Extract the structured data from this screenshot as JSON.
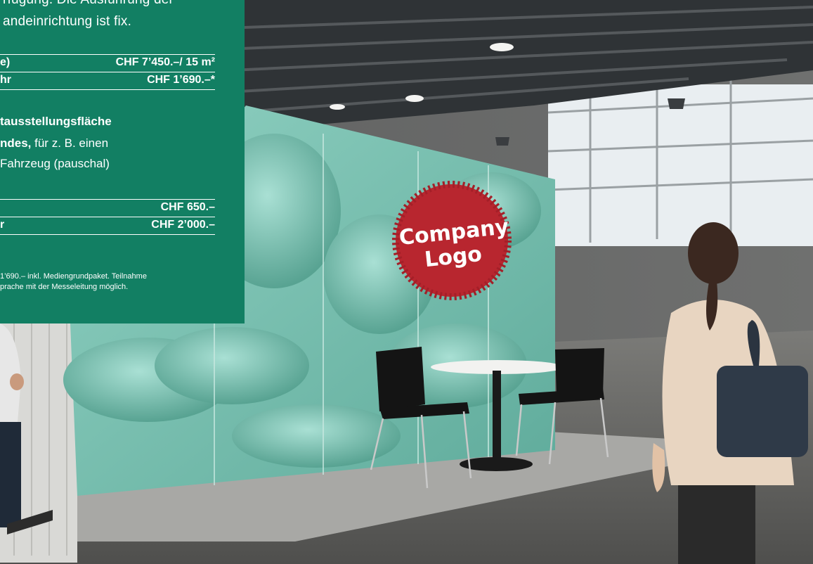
{
  "panel": {
    "intro_line1": "rfügung. Die Ausführung der",
    "intro_line2": "andeinrichtung ist fix.",
    "rows_a": [
      {
        "label": "e)",
        "value": "CHF 7’450.–/ 15 m²"
      },
      {
        "label": "hr",
        "value": "CHF 1’690.–*"
      }
    ],
    "block_lines": [
      {
        "bold": "tausstellungsfläche",
        "normal": ""
      },
      {
        "bold": "ndes,",
        "normal": " für z. B. einen"
      },
      {
        "bold": "",
        "normal": " Fahrzeug (pauschal)"
      }
    ],
    "rows_b": [
      {
        "label": "",
        "value": "CHF 650.–"
      },
      {
        "label": "r",
        "value": "CHF 2’000.–"
      }
    ],
    "footnote_line1": "1’690.– inkl. Mediengrundpaket. Teilnahme",
    "footnote_line2": "prache mit der Messeleitung möglich."
  },
  "scene": {
    "logo_line1": "Company",
    "logo_line2": "Logo",
    "colors": {
      "panel_green": "#127f63",
      "logo_red": "#b8262f",
      "wall_mint": "#7fc4b6",
      "ceiling_dark": "#2f3336",
      "floor_gray": "#6b6b68"
    }
  }
}
